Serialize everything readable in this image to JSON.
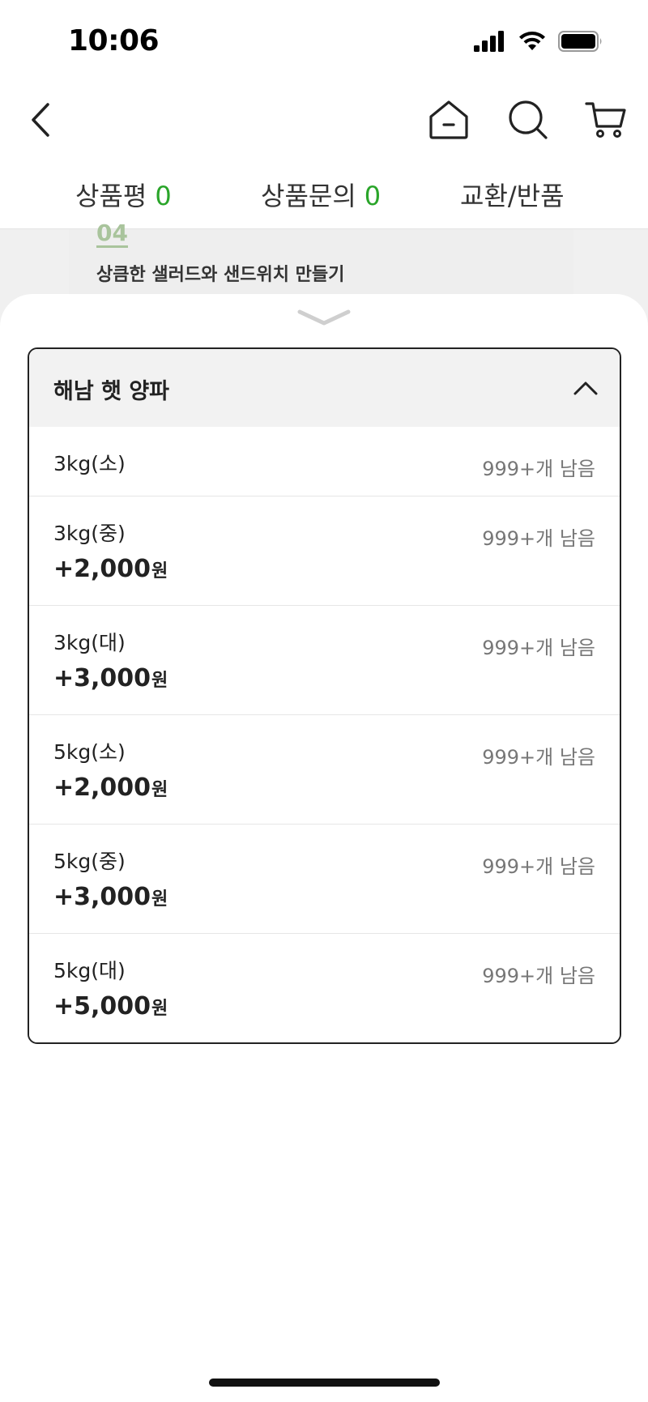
{
  "status_bar": {
    "time": "10:06"
  },
  "nav": {
    "back_icon": "chevron-left-icon",
    "home_icon": "home-icon",
    "search_icon": "search-icon",
    "cart_icon": "cart-icon"
  },
  "tabs": [
    {
      "label": "상품평",
      "count": "0"
    },
    {
      "label": "상품문의",
      "count": "0"
    },
    {
      "label": "교환/반품",
      "count": ""
    }
  ],
  "background_content": {
    "number": "04",
    "text": "상큼한 샐러드와 샌드위치 만들기"
  },
  "sheet": {
    "option_title": "해남 햇 양파",
    "items": [
      {
        "name": "3kg(소)",
        "stock": "999+개 남음",
        "price": "",
        "unit": ""
      },
      {
        "name": "3kg(중)",
        "stock": "999+개 남음",
        "price": "+2,000",
        "unit": "원"
      },
      {
        "name": "3kg(대)",
        "stock": "999+개 남음",
        "price": "+3,000",
        "unit": "원"
      },
      {
        "name": "5kg(소)",
        "stock": "999+개 남음",
        "price": "+2,000",
        "unit": "원"
      },
      {
        "name": "5kg(중)",
        "stock": "999+개 남음",
        "price": "+3,000",
        "unit": "원"
      },
      {
        "name": "5kg(대)",
        "stock": "999+개 남음",
        "price": "+5,000",
        "unit": "원"
      }
    ]
  },
  "colors": {
    "accent_green": "#2aa52a",
    "text": "#222222",
    "muted": "#777777"
  }
}
